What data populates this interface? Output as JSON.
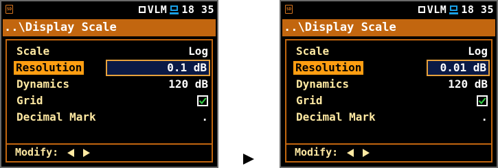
{
  "colors": {
    "title_bar": "#c2660f",
    "highlight": "#ff9e12",
    "label_text": "#ffe9a2",
    "value_box": "#0b1a46",
    "check": "#2ecc40",
    "battery": "#1aa0e6"
  },
  "screens": [
    {
      "status": {
        "sd_icon": "sd-card-icon",
        "mode": "VLM",
        "time": "18 35"
      },
      "title": "..\\Display Scale",
      "rows": [
        {
          "label": "Scale",
          "value": "Log"
        },
        {
          "label": "Resolution",
          "value": "0.1 dB",
          "selected": true
        },
        {
          "label": "Dynamics",
          "value": "120 dB"
        },
        {
          "label": "Grid",
          "checked": true
        },
        {
          "label": "Decimal Mark",
          "value": "."
        }
      ],
      "footer": {
        "label": "Modify:"
      }
    },
    {
      "status": {
        "sd_icon": "sd-card-icon",
        "mode": "VLM",
        "time": "18 35"
      },
      "title": "..\\Display Scale",
      "rows": [
        {
          "label": "Scale",
          "value": "Log"
        },
        {
          "label": "Resolution",
          "value": "0.01 dB",
          "selected": true
        },
        {
          "label": "Dynamics",
          "value": "120 dB"
        },
        {
          "label": "Grid",
          "checked": true
        },
        {
          "label": "Decimal Mark",
          "value": "."
        }
      ],
      "footer": {
        "label": "Modify:"
      }
    }
  ]
}
